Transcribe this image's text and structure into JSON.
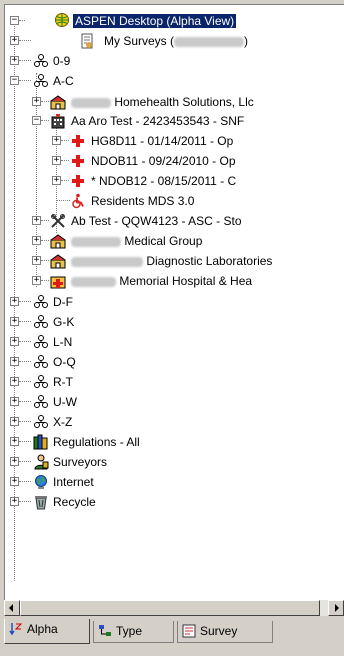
{
  "tree": {
    "root": {
      "label": "ASPEN Desktop (Alpha View)",
      "icon": "globe-icon"
    },
    "my_surveys": {
      "prefix": "My Surveys (",
      "suffix": ")"
    },
    "groups_top": [
      {
        "label": "0-9"
      },
      {
        "label": "A-C"
      }
    ],
    "ac_children": [
      {
        "label": "Homehealth Solutions, Llc",
        "redacted": true,
        "icon": "facility-icon"
      },
      {
        "label": "Aa Aro Test - 2423453543 - SNF",
        "icon": "building-icon"
      },
      {
        "label": "Ab Test - QQW4123 - ASC - Sto",
        "icon": "asc-icon"
      },
      {
        "label": "Medical Group",
        "redacted": true,
        "icon": "facility-icon"
      },
      {
        "label": "Diagnostic Laboratories",
        "redacted": true,
        "icon": "facility-icon"
      },
      {
        "label": "Memorial Hospital & Hea",
        "redacted": true,
        "icon": "hospital-icon"
      }
    ],
    "aro_children": [
      {
        "label": "HG8D11 - 01/14/2011 - Op",
        "icon": "red-cross-icon"
      },
      {
        "label": "NDOB11 - 09/24/2010 - Op",
        "icon": "red-cross-icon"
      },
      {
        "label": "* NDOB12 - 08/15/2011 - C",
        "icon": "red-cross-icon"
      },
      {
        "label": "Residents MDS 3.0",
        "icon": "wheelchair-icon"
      }
    ],
    "groups_bottom": [
      {
        "label": "D-F"
      },
      {
        "label": "G-K"
      },
      {
        "label": "L-N"
      },
      {
        "label": "O-Q"
      },
      {
        "label": "R-T"
      },
      {
        "label": "U-W"
      },
      {
        "label": "X-Z"
      }
    ],
    "misc": [
      {
        "label": "Regulations - All",
        "icon": "books-icon"
      },
      {
        "label": "Surveyors",
        "icon": "surveyor-icon"
      },
      {
        "label": "Internet",
        "icon": "internet-icon"
      },
      {
        "label": "Recycle",
        "icon": "recycle-bin-icon"
      }
    ]
  },
  "tabs": [
    {
      "label": "Alpha",
      "active": true,
      "icon": "sort-alpha-icon"
    },
    {
      "label": "Type",
      "active": false,
      "icon": "type-icon"
    },
    {
      "label": "Survey",
      "active": false,
      "icon": "survey-icon"
    }
  ]
}
